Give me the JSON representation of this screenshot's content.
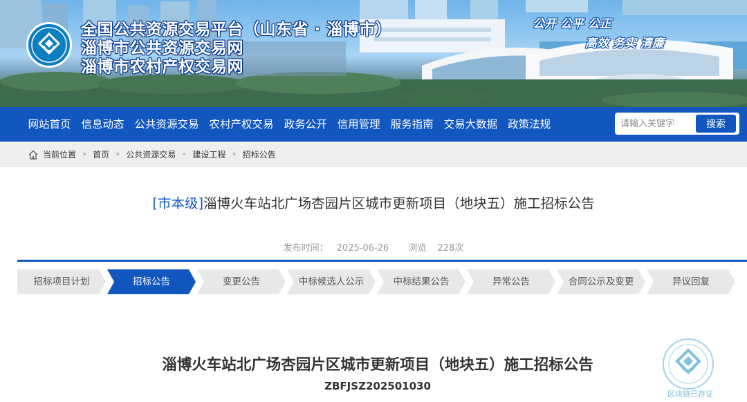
{
  "header": {
    "titles": [
      "全国公共资源交易平台（山东省 · 淄博市）",
      "淄博市公共资源交易网",
      "淄博市农村产权交易网"
    ],
    "slogan_line1": "公开 公平 公正",
    "slogan_line2": "高效 务实 清廉"
  },
  "nav": {
    "items": [
      "网站首页",
      "信息动态",
      "公共资源交易",
      "农村产权交易",
      "政务公开",
      "信用管理",
      "服务指南",
      "交易大数据",
      "政策法规"
    ],
    "search_placeholder": "请输入关键字",
    "search_button": "搜索"
  },
  "breadcrumb": {
    "label": "当前位置",
    "items": [
      "首页",
      "公共资源交易",
      "建设工程",
      "招标公告"
    ]
  },
  "article": {
    "level_tag": "[市本级]",
    "title": "淄博火车站北广场杏园片区城市更新项目（地块五）施工招标公告",
    "publish_label": "发布时间：",
    "publish_date": "2025-06-26",
    "views_label": "浏览",
    "views_count": "228次"
  },
  "steps": {
    "items": [
      "招标项目计划",
      "招标公告",
      "变更公告",
      "中标候选人公示",
      "中标结果公告",
      "异常公告",
      "合同公示及变更",
      "异议回复"
    ],
    "active_index": 1
  },
  "document": {
    "title": "淄博火车站北广场杏园片区城市更新项目（地块五）施工招标公告",
    "code": "ZBFJSZ202501030"
  },
  "stamp": {
    "label": "区块链已存证"
  },
  "colors": {
    "primary": "#1157bf",
    "tab_inactive": "#e8e8e8",
    "breadcrumb_bg": "#efefef",
    "stamp": "#7cc3dc"
  }
}
